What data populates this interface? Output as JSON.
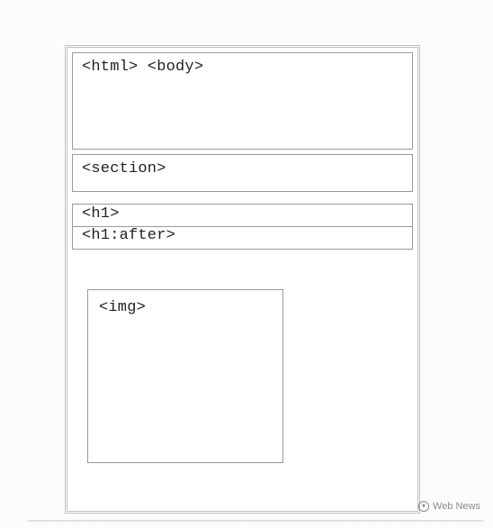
{
  "diagram": {
    "html_body": "<html> <body>",
    "section": "<section>",
    "h1": "<h1>",
    "h1_after": "<h1:after>",
    "img": "<img>"
  },
  "watermark": {
    "text": "Web News"
  }
}
